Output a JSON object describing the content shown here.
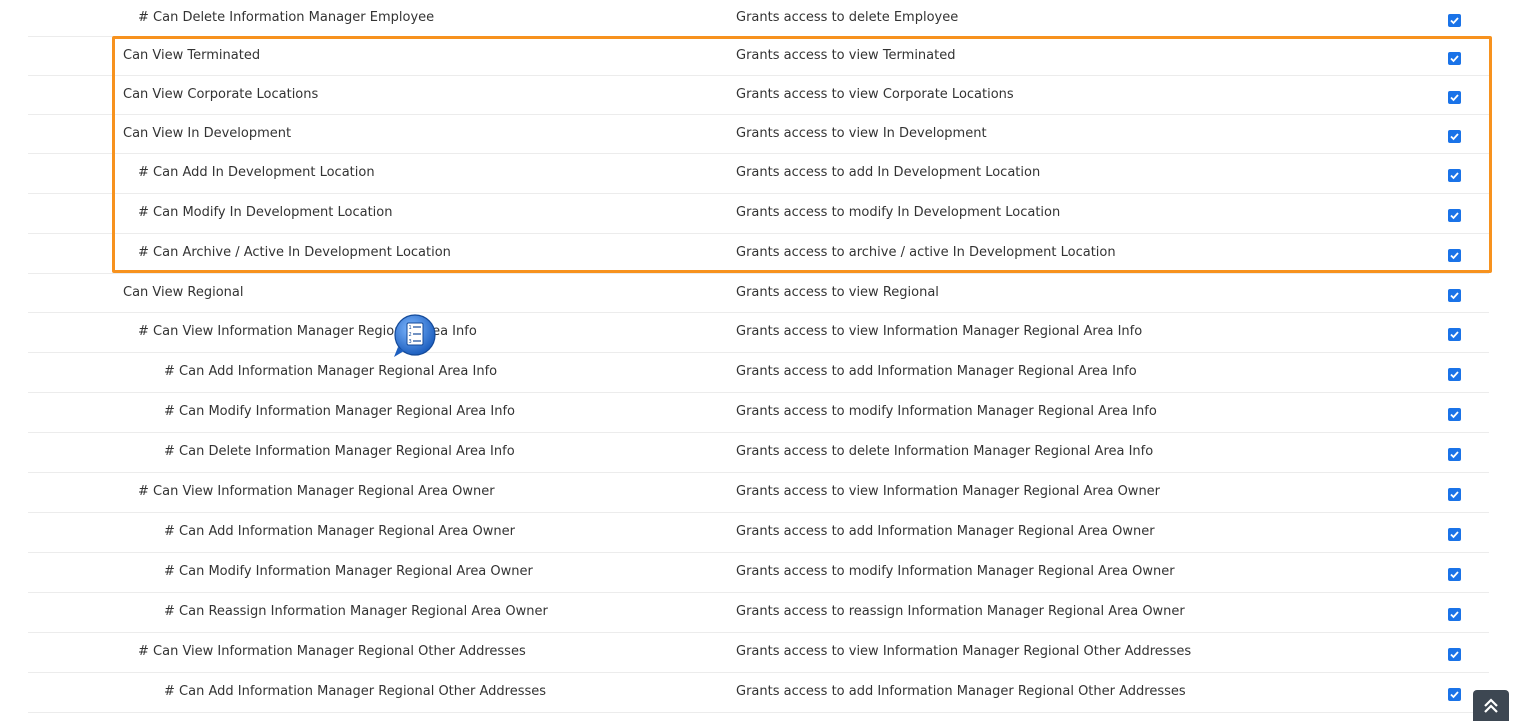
{
  "permissions": [
    {
      "indent": 1,
      "name": "# Can Delete Information Manager Employee",
      "description": "Grants access to delete Employee",
      "checked": true
    },
    {
      "indent": 0,
      "name": "Can View Terminated",
      "description": "Grants access to view Terminated",
      "checked": true
    },
    {
      "indent": 0,
      "name": "Can View Corporate Locations",
      "description": "Grants access to view Corporate Locations",
      "checked": true
    },
    {
      "indent": 0,
      "name": "Can View In Development",
      "description": "Grants access to view In Development",
      "checked": true
    },
    {
      "indent": 1,
      "name": "# Can Add In Development Location",
      "description": "Grants access to add In Development Location",
      "checked": true
    },
    {
      "indent": 1,
      "name": "# Can Modify In Development Location",
      "description": "Grants access to modify In Development Location",
      "checked": true
    },
    {
      "indent": 1,
      "name": "# Can Archive / Active In Development Location",
      "description": "Grants access to archive / active In Development Location",
      "checked": true
    },
    {
      "indent": 0,
      "name": "Can View Regional",
      "description": "Grants access to view Regional",
      "checked": true
    },
    {
      "indent": 1,
      "name": "# Can View Information Manager Regional Area Info",
      "description": "Grants access to view Information Manager Regional Area Info",
      "checked": true
    },
    {
      "indent": 2,
      "name": "# Can Add Information Manager Regional Area Info",
      "description": "Grants access to add Information Manager Regional Area Info",
      "checked": true
    },
    {
      "indent": 2,
      "name": "# Can Modify Information Manager Regional Area Info",
      "description": "Grants access to modify Information Manager Regional Area Info",
      "checked": true
    },
    {
      "indent": 2,
      "name": "# Can Delete Information Manager Regional Area Info",
      "description": "Grants access to delete Information Manager Regional Area Info",
      "checked": true
    },
    {
      "indent": 1,
      "name": "# Can View Information Manager Regional Area Owner",
      "description": "Grants access to view Information Manager Regional Area Owner",
      "checked": true
    },
    {
      "indent": 2,
      "name": "# Can Add Information Manager Regional Area Owner",
      "description": "Grants access to add Information Manager Regional Area Owner",
      "checked": true
    },
    {
      "indent": 2,
      "name": "# Can Modify Information Manager Regional Area Owner",
      "description": "Grants access to modify Information Manager Regional Area Owner",
      "checked": true
    },
    {
      "indent": 2,
      "name": "# Can Reassign Information Manager Regional Area Owner",
      "description": "Grants access to reassign Information Manager Regional Area Owner",
      "checked": true
    },
    {
      "indent": 1,
      "name": "# Can View Information Manager Regional Other Addresses",
      "description": "Grants access to view Information Manager Regional Other Addresses",
      "checked": true
    },
    {
      "indent": 2,
      "name": "# Can Add Information Manager Regional Other Addresses",
      "description": "Grants access to add Information Manager Regional Other Addresses",
      "checked": true
    }
  ],
  "highlight_color": "#f7921e",
  "checkbox_color": "#1a73e8",
  "icons": {
    "cursor": "checklist-cursor-icon",
    "scroll_top": "double-chevron-up-icon"
  }
}
